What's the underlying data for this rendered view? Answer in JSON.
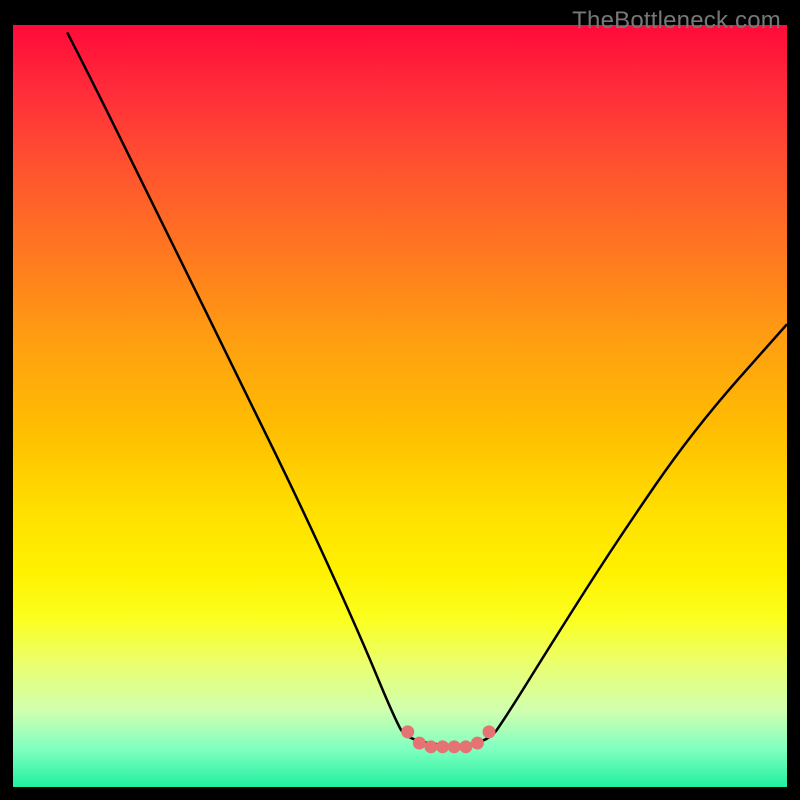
{
  "watermark": "TheBottleneck.com",
  "colors": {
    "background": "#000000",
    "curve_stroke": "#000000",
    "marker_fill": "#e57373",
    "gradient_stops": [
      {
        "offset": 0,
        "color": "#ff0a3a"
      },
      {
        "offset": 18,
        "color": "#ff5030"
      },
      {
        "offset": 42,
        "color": "#ffa010"
      },
      {
        "offset": 64,
        "color": "#ffe000"
      },
      {
        "offset": 84,
        "color": "#eaff70"
      },
      {
        "offset": 100,
        "color": "#20f0a0"
      }
    ]
  },
  "chart_data": {
    "type": "line",
    "title": "",
    "xlabel": "",
    "ylabel": "",
    "xlim": [
      0,
      100
    ],
    "ylim": [
      0,
      100
    ],
    "left_branch": [
      {
        "x": 7,
        "y": 99
      },
      {
        "x": 10,
        "y": 93
      },
      {
        "x": 20,
        "y": 72
      },
      {
        "x": 30,
        "y": 51
      },
      {
        "x": 38,
        "y": 34
      },
      {
        "x": 45,
        "y": 18
      },
      {
        "x": 49,
        "y": 8
      },
      {
        "x": 51,
        "y": 4
      }
    ],
    "flat_segment": [
      {
        "x": 51,
        "y": 3.5
      },
      {
        "x": 61,
        "y": 3.5
      }
    ],
    "right_branch": [
      {
        "x": 61,
        "y": 4
      },
      {
        "x": 64,
        "y": 8
      },
      {
        "x": 70,
        "y": 18
      },
      {
        "x": 78,
        "y": 31
      },
      {
        "x": 88,
        "y": 46
      },
      {
        "x": 100,
        "y": 60
      }
    ],
    "markers": [
      {
        "x": 51,
        "y": 5.5
      },
      {
        "x": 52.5,
        "y": 4
      },
      {
        "x": 54,
        "y": 3.5
      },
      {
        "x": 55.5,
        "y": 3.5
      },
      {
        "x": 57,
        "y": 3.5
      },
      {
        "x": 58.5,
        "y": 3.5
      },
      {
        "x": 60,
        "y": 4
      },
      {
        "x": 61.5,
        "y": 5.5
      }
    ]
  }
}
